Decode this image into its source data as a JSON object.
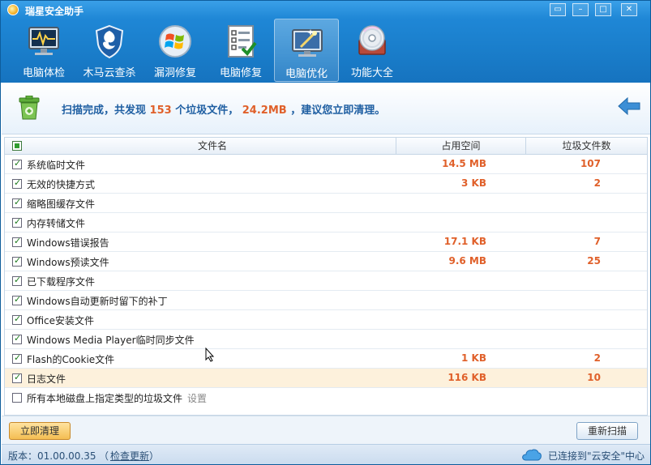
{
  "app": {
    "title": "瑞星安全助手"
  },
  "window_controls": {
    "restore": "▭",
    "minimize": "–",
    "maximize": "□",
    "close": "✕"
  },
  "toolbar": {
    "items": [
      {
        "label": "电脑体检",
        "icon": "monitor-heartbeat-icon",
        "active": false
      },
      {
        "label": "木马云查杀",
        "icon": "shield-icon",
        "active": false
      },
      {
        "label": "漏洞修复",
        "icon": "windows-logo-icon",
        "active": false
      },
      {
        "label": "电脑修复",
        "icon": "checklist-icon",
        "active": false
      },
      {
        "label": "电脑优化",
        "icon": "magic-wand-monitor-icon",
        "active": true
      },
      {
        "label": "功能大全",
        "icon": "disc-icon",
        "active": false
      }
    ]
  },
  "summary": {
    "prefix": "扫描完成，共发现",
    "file_count": "153",
    "middle": "个垃圾文件，",
    "size": "24.2MB",
    "suffix": "，建议您立即清理。"
  },
  "table": {
    "columns": {
      "name": "文件名",
      "space": "占用空间",
      "count": "垃圾文件数"
    },
    "rows": [
      {
        "name": "系统临时文件",
        "size": "14.5 MB",
        "count": "107",
        "checked": true
      },
      {
        "name": "无效的快捷方式",
        "size": "3 KB",
        "count": "2",
        "checked": true
      },
      {
        "name": "缩略图缓存文件",
        "size": "",
        "count": "",
        "checked": true
      },
      {
        "name": "内存转储文件",
        "size": "",
        "count": "",
        "checked": true
      },
      {
        "name": "Windows错误报告",
        "size": "17.1 KB",
        "count": "7",
        "checked": true
      },
      {
        "name": "Windows预读文件",
        "size": "9.6 MB",
        "count": "25",
        "checked": true
      },
      {
        "name": "已下载程序文件",
        "size": "",
        "count": "",
        "checked": true
      },
      {
        "name": "Windows自动更新时留下的补丁",
        "size": "",
        "count": "",
        "checked": true
      },
      {
        "name": "Office安装文件",
        "size": "",
        "count": "",
        "checked": true
      },
      {
        "name": "Windows Media Player临时同步文件",
        "size": "",
        "count": "",
        "checked": true
      },
      {
        "name": "Flash的Cookie文件",
        "size": "1 KB",
        "count": "2",
        "checked": true
      },
      {
        "name": "日志文件",
        "size": "116 KB",
        "count": "10",
        "checked": true,
        "highlight": true
      },
      {
        "name": "所有本地磁盘上指定类型的垃圾文件",
        "size": "",
        "count": "",
        "checked": false,
        "extra": "设置"
      }
    ]
  },
  "buttons": {
    "clean": "立即清理",
    "rescan": "重新扫描"
  },
  "status": {
    "version": "版本：01.00.00.35",
    "paren_open": "（",
    "update": "检查更新",
    "paren_close": "）",
    "cloud": "已连接到\"云安全\"中心"
  },
  "colors": {
    "accent_blue": "#1a7ecb",
    "highlight_orange": "#e0602a",
    "selected_row": "#fdf1dc"
  }
}
